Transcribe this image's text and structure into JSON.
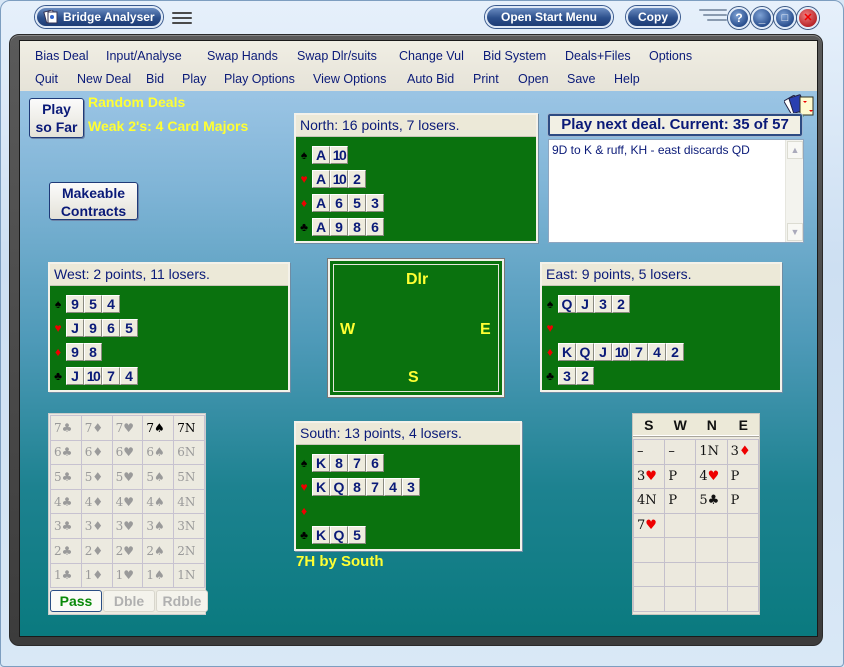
{
  "window": {
    "title": "Bridge Analyser",
    "open_start_menu": "Open Start Menu",
    "copy": "Copy",
    "controls": {
      "help": "?",
      "minimize": "_",
      "maximize": "□",
      "close": "✕"
    }
  },
  "menu": {
    "row1": [
      "Bias Deal",
      "Input/Analyse",
      "Swap Hands",
      "Swap Dlr/suits",
      "Change Vul",
      "Bid System",
      "Deals+Files",
      "Options"
    ],
    "row2": [
      "Quit",
      "New Deal",
      "Bid",
      "Play",
      "Play Options",
      "View Options",
      "Auto Bid",
      "Print",
      "Open",
      "Save",
      "Help"
    ]
  },
  "play_so_far": {
    "line1": "Play",
    "line2": "so Far"
  },
  "deal_type": "Random Deals",
  "bid_system": "Weak 2's: 4 Card Majors",
  "makeable": {
    "line1": "Makeable",
    "line2": "Contracts"
  },
  "next_deal": "Play next deal. Current: 35 of 57",
  "notes_text": "9D to K & ruff, KH - east discards QD",
  "hands": {
    "north": {
      "header": "North: 16 points, 7 losers.",
      "spades": [
        "A",
        "10"
      ],
      "hearts": [
        "A",
        "10",
        "2"
      ],
      "diamonds": [
        "A",
        "6",
        "5",
        "3"
      ],
      "clubs": [
        "A",
        "9",
        "8",
        "6"
      ]
    },
    "west": {
      "header": "West: 2 points, 11 losers.",
      "spades": [
        "9",
        "5",
        "4"
      ],
      "hearts": [
        "J",
        "9",
        "6",
        "5"
      ],
      "diamonds": [
        "9",
        "8"
      ],
      "clubs": [
        "J",
        "10",
        "7",
        "4"
      ]
    },
    "east": {
      "header": "East: 9 points, 5 losers.",
      "spades": [
        "Q",
        "J",
        "3",
        "2"
      ],
      "hearts": [],
      "diamonds": [
        "K",
        "Q",
        "J",
        "10",
        "7",
        "4",
        "2"
      ],
      "clubs": [
        "3",
        "2"
      ]
    },
    "south": {
      "header": "South: 13 points, 4 losers.",
      "spades": [
        "K",
        "8",
        "7",
        "6"
      ],
      "hearts": [
        "K",
        "Q",
        "8",
        "7",
        "4",
        "3"
      ],
      "diamonds": [],
      "clubs": [
        "K",
        "Q",
        "5"
      ]
    }
  },
  "table": {
    "north": "Dlr",
    "west": "W",
    "east": "E",
    "south": "S"
  },
  "suit_symbols": {
    "spades": "♠",
    "hearts": "♥",
    "diamonds": "♦",
    "clubs": "♣"
  },
  "bidding_box": {
    "rows": [
      [
        "7♣",
        "7♦",
        "7♥",
        "7♠",
        "7N"
      ],
      [
        "6♣",
        "6♦",
        "6♥",
        "6♠",
        "6N"
      ],
      [
        "5♣",
        "5♦",
        "5♥",
        "5♠",
        "5N"
      ],
      [
        "4♣",
        "4♦",
        "4♥",
        "4♠",
        "4N"
      ],
      [
        "3♣",
        "3♦",
        "3♥",
        "3♠",
        "3N"
      ],
      [
        "2♣",
        "2♦",
        "2♥",
        "2♠",
        "2N"
      ],
      [
        "1♣",
        "1♦",
        "1♥",
        "1♠",
        "1N"
      ]
    ],
    "available": [
      "7♠",
      "7N"
    ],
    "pass": "Pass",
    "double": "Dble",
    "redouble": "Rdble"
  },
  "auction": {
    "headers": [
      "S",
      "W",
      "N",
      "E"
    ],
    "rows": [
      [
        "–",
        "–",
        "1N",
        "3♦"
      ],
      [
        "3♥",
        "P",
        "4♥",
        "P"
      ],
      [
        "4N",
        "P",
        "5♣",
        "P"
      ],
      [
        "7♥",
        "",
        "",
        ""
      ],
      [
        "",
        "",
        "",
        ""
      ],
      [
        "",
        "",
        "",
        ""
      ],
      [
        "",
        "",
        "",
        ""
      ]
    ]
  },
  "contract": "7H by South",
  "colors": {
    "felt": "#0a720e",
    "highlight_text": "#ffff33",
    "card_text": "#0a1a78",
    "red_suit": "#ee0000"
  }
}
